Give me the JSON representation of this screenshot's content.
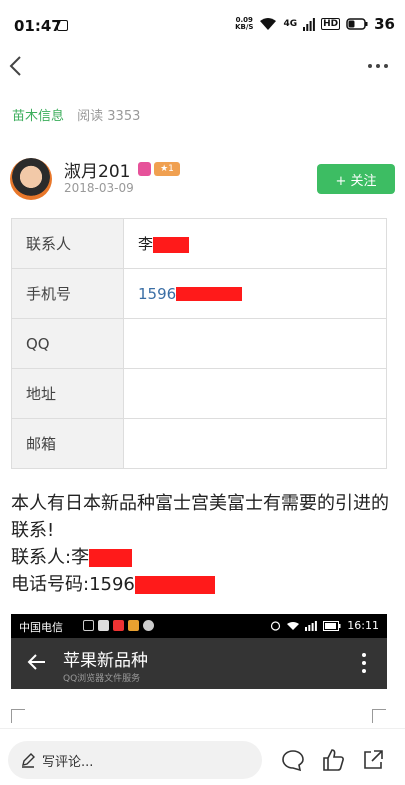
{
  "status_bar": {
    "time": "01:47",
    "net_speed_value": "0.09",
    "net_speed_unit": "KB/S",
    "network": "4G",
    "hd": "HD",
    "battery": "36"
  },
  "nav": {
    "back_icon": "chevron-left-icon",
    "more_icon": "more-horizontal-icon"
  },
  "meta": {
    "category": "苗木信息",
    "reads": "阅读 3353"
  },
  "author": {
    "name": "淑月201",
    "date": "2018-03-09",
    "star_badge": "★1",
    "follow_label": "+ 关注"
  },
  "contact_table": {
    "rows": [
      {
        "key": "联系人",
        "value": "李"
      },
      {
        "key": "手机号",
        "value": "1596"
      },
      {
        "key": "QQ",
        "value": ""
      },
      {
        "key": "地址",
        "value": ""
      },
      {
        "key": "邮箱",
        "value": ""
      }
    ]
  },
  "post": {
    "line1": "本人有日本新品种富士宫美富士有需要的引进的联系!",
    "line2": "联系人:李",
    "line3": "电话号码:1596"
  },
  "embedded_screenshot": {
    "carrier": "中国电信",
    "time": "16:11",
    "title": "苹果新品种",
    "subtitle": "QQ浏览器文件服务"
  },
  "bottom_bar": {
    "comment_placeholder": "写评论...",
    "icons": [
      "pencil-icon",
      "comment-icon",
      "like-icon",
      "share-icon"
    ]
  },
  "colors": {
    "accent_green": "#3dbd63",
    "category_green": "#3cae5c",
    "redaction": "#ff1a1a",
    "phone_link": "#3a6ea5"
  }
}
